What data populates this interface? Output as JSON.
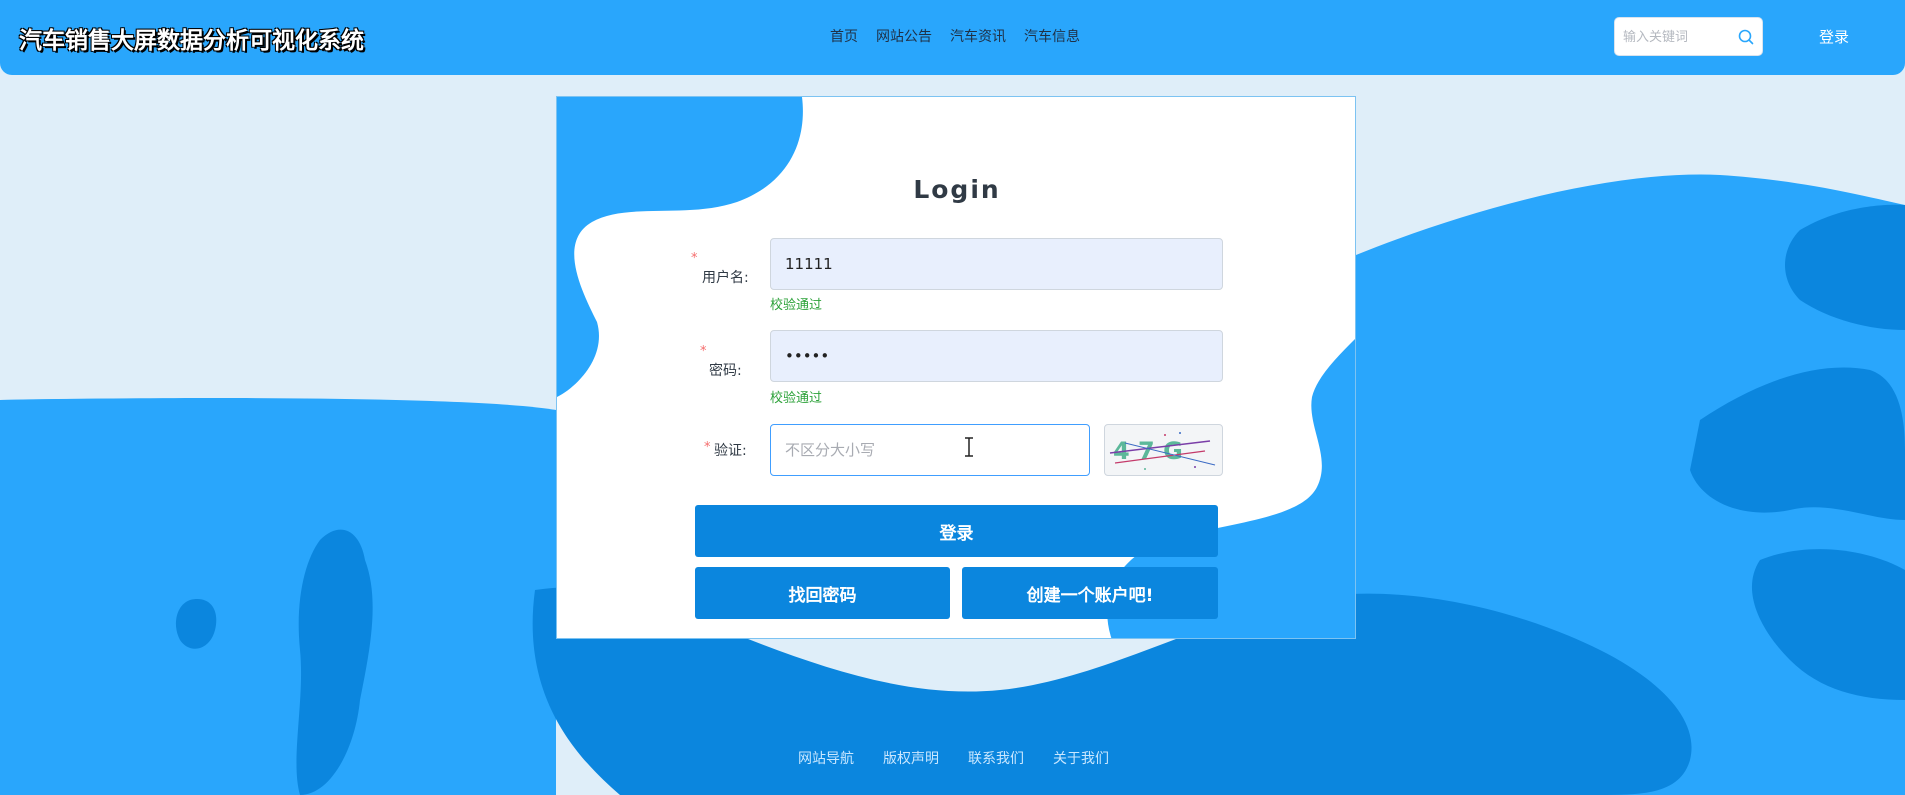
{
  "header": {
    "title": "汽车销售大屏数据分析可视化系统",
    "nav": [
      "首页",
      "网站公告",
      "汽车资讯",
      "汽车信息"
    ],
    "search_placeholder": "输入关键词",
    "login_label": "登录"
  },
  "form": {
    "title": "Login",
    "username_label": "用户名:",
    "username_value": "11111",
    "username_status": "校验通过",
    "password_label": "密码:",
    "password_value": "•••••",
    "password_status": "校验通过",
    "captcha_label": "验证:",
    "captcha_placeholder": "不区分大小写",
    "captcha_text": "4 7 G",
    "required_mark": "*",
    "login_button": "登录",
    "forgot_button": "找回密码",
    "register_button": "创建一个账户吧!"
  },
  "footer": {
    "links": [
      "网站导航",
      "版权声明",
      "联系我们",
      "关于我们"
    ]
  },
  "colors": {
    "header_bg": "#29a6fc",
    "primary_button": "#0b86de",
    "wave_light": "#29a6fc",
    "wave_dark": "#0b86de",
    "valid_green": "#2da23a",
    "required_red": "#f56c6c"
  }
}
